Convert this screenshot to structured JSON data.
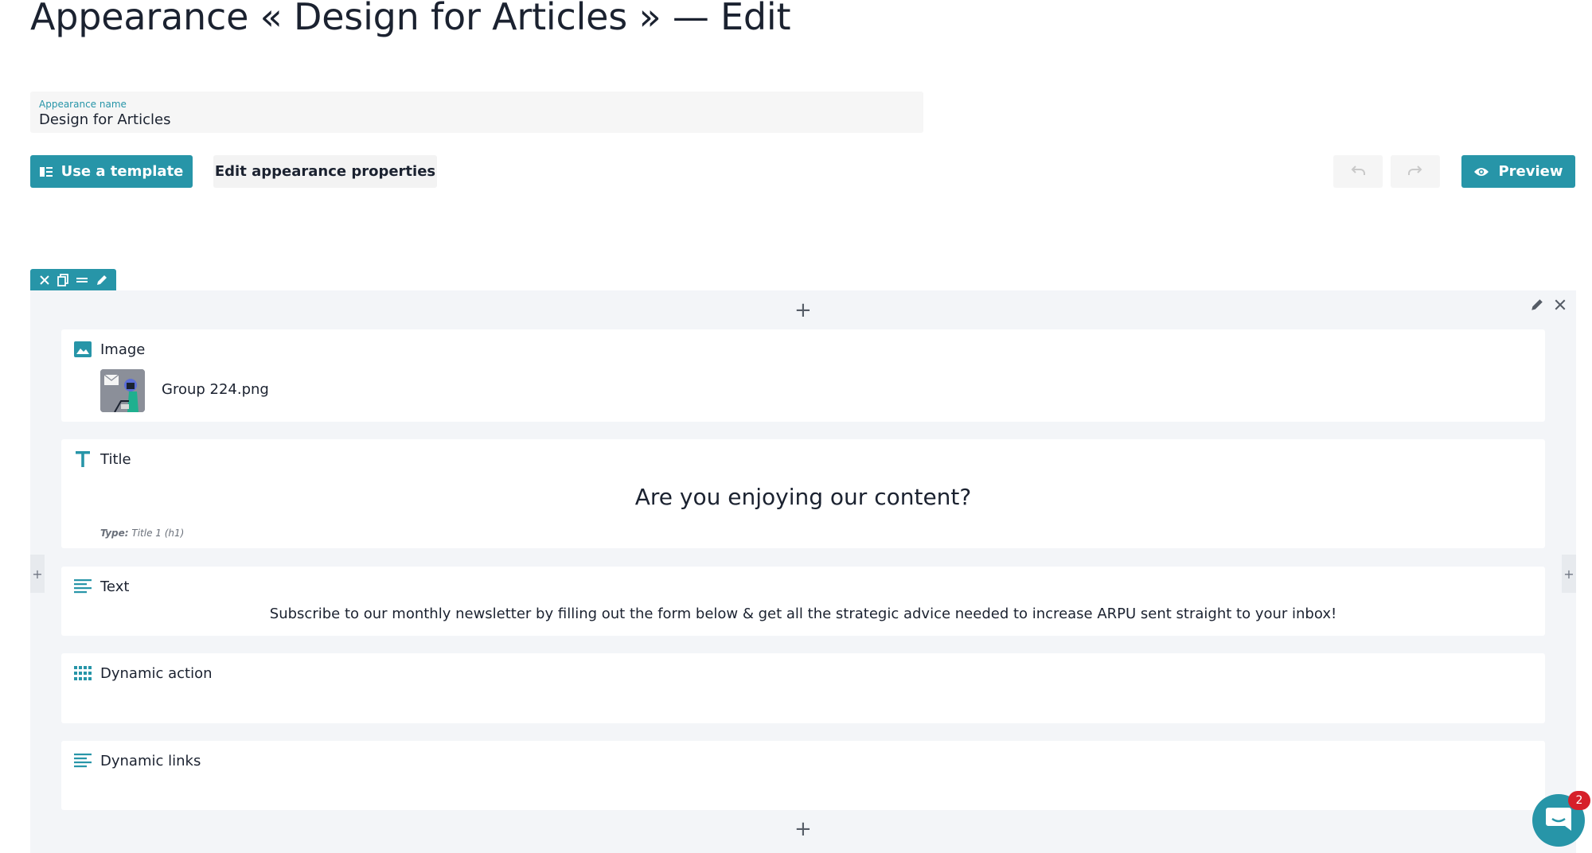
{
  "page": {
    "title": "Appearance « Design for Articles » — Edit"
  },
  "name_field": {
    "label": "Appearance name",
    "value": "Design for Articles"
  },
  "toolbar": {
    "use_template": "Use a template",
    "edit_properties": "Edit appearance properties",
    "preview": "Preview"
  },
  "canvas": {
    "add_symbol": "+"
  },
  "blocks": {
    "image": {
      "name": "Image",
      "file_name": "Group 224.png"
    },
    "title": {
      "name": "Title",
      "text": "Are you enjoying our content?",
      "type_label": "Type:",
      "type_value": "Title 1 (h1)"
    },
    "text": {
      "name": "Text",
      "text": "Subscribe to our monthly newsletter by filling out the form below & get all the strategic advice needed to increase ARPU sent straight to your inbox!"
    },
    "dynamic_action": {
      "name": "Dynamic action"
    },
    "dynamic_links": {
      "name": "Dynamic links"
    }
  },
  "chat": {
    "badge_count": "2"
  },
  "colors": {
    "accent": "#2795a8",
    "badge": "#d6202a",
    "canvas_bg": "#f3f5f8"
  },
  "icons": [
    "template-icon",
    "undo-icon",
    "redo-icon",
    "eye-icon",
    "close-icon",
    "copy-icon",
    "drag-handle-icon",
    "pencil-icon",
    "image-icon",
    "title-t-icon",
    "text-lines-icon",
    "grid-icon",
    "chat-icon"
  ]
}
